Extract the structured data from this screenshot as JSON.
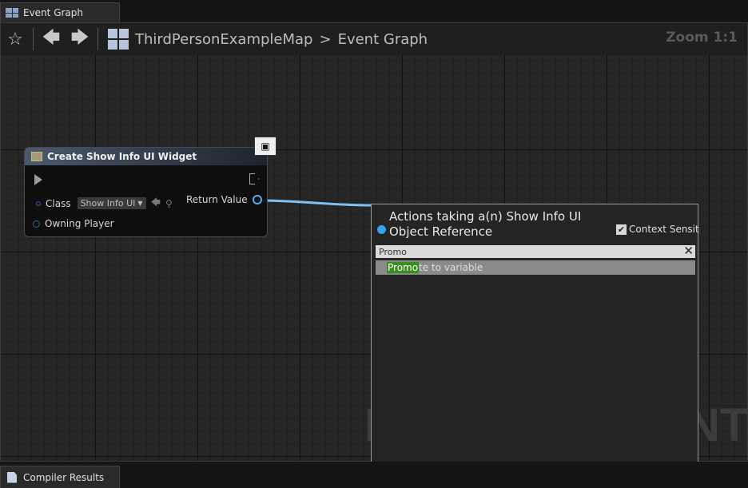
{
  "tabs": {
    "top": {
      "label": "Event Graph",
      "icon": "blueprint-graph-icon"
    },
    "bottom": {
      "label": "Compiler Results",
      "icon": "document-icon"
    }
  },
  "toolbar": {
    "favorite_icon": "star-icon",
    "back_icon": "arrow-left-icon",
    "forward_icon": "arrow-right-icon",
    "breadcrumb_icon": "level-blueprint-icon",
    "breadcrumb": [
      "ThirdPersonExampleMap",
      "Event Graph"
    ],
    "breadcrumb_separator": ">",
    "zoom": "Zoom 1:1"
  },
  "watermark": {
    "text": "I",
    "right_text": "NT"
  },
  "node": {
    "title": "Create Show Info UI Widget",
    "class_label": "Class",
    "class_value": "Show Info UI",
    "return_label": "Return Value",
    "owning_label": "Owning Player",
    "pin_color": "#5aa8ea"
  },
  "menu": {
    "title": "Actions taking a(n) Show Info UI Object Reference",
    "context_label": "Context Sensitive",
    "context_checked": "✔",
    "search_value": "Promo",
    "result_match": "Promo",
    "result_rest": "te to variable",
    "accent": "#3b8d1e"
  }
}
